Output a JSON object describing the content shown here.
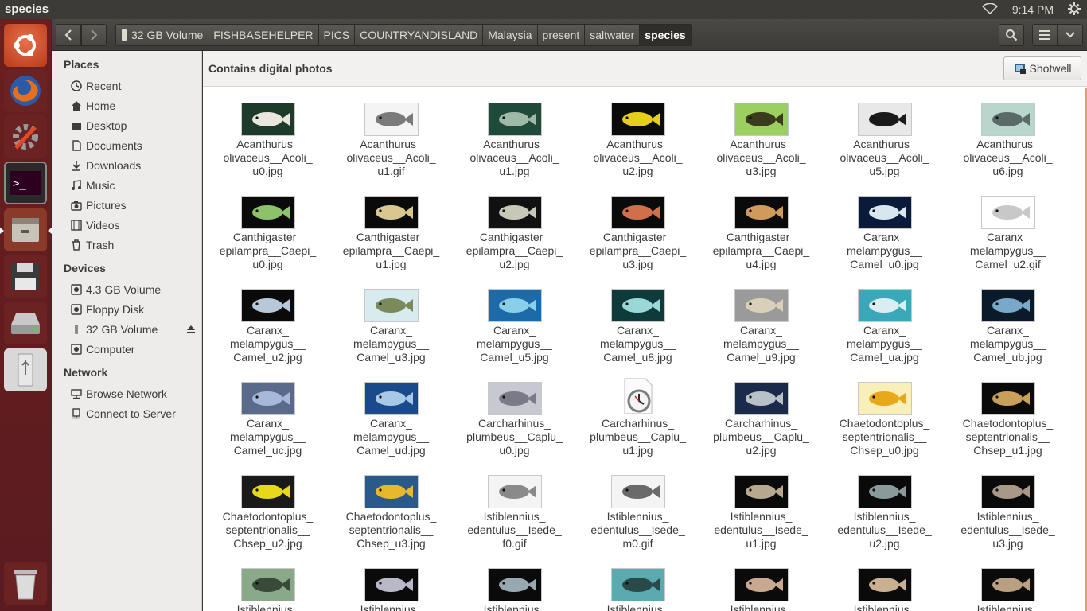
{
  "window": {
    "title": "species",
    "time": "9:14 PM"
  },
  "launcher": [
    {
      "name": "ubuntu-dash-icon"
    },
    {
      "name": "firefox-icon"
    },
    {
      "name": "system-settings-icon"
    },
    {
      "name": "terminal-icon"
    },
    {
      "name": "files-icon"
    },
    {
      "name": "floppy-disk-icon"
    },
    {
      "name": "hard-drive-icon"
    },
    {
      "name": "usb-drive-icon"
    },
    {
      "name": "trash-icon"
    }
  ],
  "breadcrumbs": [
    "32 GB Volume",
    "FISHBASEHELPER",
    "PICS",
    "COUNTRYANDISLAND",
    "Malaysia",
    "present",
    "saltwater",
    "species"
  ],
  "sidebar": {
    "places_heading": "Places",
    "places": [
      "Recent",
      "Home",
      "Desktop",
      "Documents",
      "Downloads",
      "Music",
      "Pictures",
      "Videos",
      "Trash"
    ],
    "devices_heading": "Devices",
    "devices": [
      "4.3 GB Volume",
      "Floppy Disk",
      "32 GB Volume",
      "Computer"
    ],
    "network_heading": "Network",
    "network": [
      "Browse Network",
      "Connect to Server"
    ]
  },
  "infobar": {
    "message": "Contains digital photos",
    "button": "Shotwell"
  },
  "files": [
    {
      "name": "Acanthurus_\nolivaceus__Acoli_\nu0.jpg",
      "bg": "#1d3a2a",
      "fish": "#e8e6dd"
    },
    {
      "name": "Acanthurus_\nolivaceus__Acoli_\nu1.gif",
      "bg": "#f4f4f4",
      "fish": "#7a7a7a"
    },
    {
      "name": "Acanthurus_\nolivaceus__Acoli_\nu1.jpg",
      "bg": "#1f4a3a",
      "fish": "#9fb9a8"
    },
    {
      "name": "Acanthurus_\nolivaceus__Acoli_\nu2.jpg",
      "bg": "#0a0a0a",
      "fish": "#e6cf1a"
    },
    {
      "name": "Acanthurus_\nolivaceus__Acoli_\nu3.jpg",
      "bg": "#9ccf61",
      "fish": "#3a3a1c"
    },
    {
      "name": "Acanthurus_\nolivaceus__Acoli_\nu5.jpg",
      "bg": "#e8e8e8",
      "fish": "#1a1a1a"
    },
    {
      "name": "Acanthurus_\nolivaceus__Acoli_\nu6.jpg",
      "bg": "#b8d6cc",
      "fish": "#5a6a66"
    },
    {
      "name": "Canthigaster_\nepilampra__Caepi_\nu0.jpg",
      "bg": "#0a0a0a",
      "fish": "#8ec26a"
    },
    {
      "name": "Canthigaster_\nepilampra__Caepi_\nu1.jpg",
      "bg": "#0a0a0a",
      "fish": "#d8c890"
    },
    {
      "name": "Canthigaster_\nepilampra__Caepi_\nu2.jpg",
      "bg": "#111111",
      "fish": "#c8c8b8"
    },
    {
      "name": "Canthigaster_\nepilampra__Caepi_\nu3.jpg",
      "bg": "#0a0a0a",
      "fish": "#d0704a"
    },
    {
      "name": "Canthigaster_\nepilampra__Caepi_\nu4.jpg",
      "bg": "#0a0a0a",
      "fish": "#d09a5a"
    },
    {
      "name": "Caranx_\nmelampygus__\nCamel_u0.jpg",
      "bg": "#0a1a3a",
      "fish": "#d8e6f0"
    },
    {
      "name": "Caranx_\nmelampygus__\nCamel_u2.gif",
      "bg": "#ffffff",
      "fish": "#c8c8c8"
    },
    {
      "name": "Caranx_\nmelampygus__\nCamel_u2.jpg",
      "bg": "#0a0a0a",
      "fish": "#b8c8d8"
    },
    {
      "name": "Caranx_\nmelampygus__\nCamel_u3.jpg",
      "bg": "#d8ecef",
      "fish": "#7a8a5a"
    },
    {
      "name": "Caranx_\nmelampygus__\nCamel_u5.jpg",
      "bg": "#1c6aa8",
      "fish": "#8acfe8"
    },
    {
      "name": "Caranx_\nmelampygus__\nCamel_u8.jpg",
      "bg": "#0e3a3a",
      "fish": "#9ad8d8"
    },
    {
      "name": "Caranx_\nmelampygus__\nCamel_u9.jpg",
      "bg": "#9a9a9a",
      "fish": "#d8d0b8"
    },
    {
      "name": "Caranx_\nmelampygus__\nCamel_ua.jpg",
      "bg": "#3aa8b8",
      "fish": "#d8eef0"
    },
    {
      "name": "Caranx_\nmelampygus__\nCamel_ub.jpg",
      "bg": "#0a1a2a",
      "fish": "#7aa8c8"
    },
    {
      "name": "Caranx_\nmelampygus__\nCamel_uc.jpg",
      "bg": "#5a6a8a",
      "fish": "#a8b8d8"
    },
    {
      "name": "Caranx_\nmelampygus__\nCamel_ud.jpg",
      "bg": "#1a4a8a",
      "fish": "#a8c8e8"
    },
    {
      "name": "Carcharhinus_\nplumbeus__Caplu_\nu0.jpg",
      "bg": "#c8c8d0",
      "fish": "#7a7a88"
    },
    {
      "name": "Carcharhinus_\nplumbeus__Caplu_\nu1.jpg",
      "bg": "#ffffff",
      "fish": "#888888",
      "clock": true
    },
    {
      "name": "Carcharhinus_\nplumbeus__Caplu_\nu2.jpg",
      "bg": "#1a2a4a",
      "fish": "#b8c0c8"
    },
    {
      "name": "Chaetodontoplus_\nseptentrionalis__\nChsep_u0.jpg",
      "bg": "#f8f0b8",
      "fish": "#e8a81a"
    },
    {
      "name": "Chaetodontoplus_\nseptentrionalis__\nChsep_u1.jpg",
      "bg": "#0a0a0a",
      "fish": "#c8a05a"
    },
    {
      "name": "Chaetodontoplus_\nseptentrionalis__\nChsep_u2.jpg",
      "bg": "#1a1a1a",
      "fish": "#e8d81a"
    },
    {
      "name": "Chaetodontoplus_\nseptentrionalis__\nChsep_u3.jpg",
      "bg": "#2a5a8a",
      "fish": "#e8b82a"
    },
    {
      "name": "Istiblennius_\nedentulus__Isede_\nf0.gif",
      "bg": "#f4f4f4",
      "fish": "#8a8a8a"
    },
    {
      "name": "Istiblennius_\nedentulus__Isede_\nm0.gif",
      "bg": "#f4f4f4",
      "fish": "#6a6a6a"
    },
    {
      "name": "Istiblennius_\nedentulus__Isede_\nu1.jpg",
      "bg": "#0a0a0a",
      "fish": "#b8a890"
    },
    {
      "name": "Istiblennius_\nedentulus__Isede_\nu2.jpg",
      "bg": "#0a0a0a",
      "fish": "#8a9a9a"
    },
    {
      "name": "Istiblennius_\nedentulus__Isede_\nu3.jpg",
      "bg": "#0a0a0a",
      "fish": "#a89888"
    },
    {
      "name": "Istiblennius_\nedentulus__Isede",
      "bg": "#8aa88a",
      "fish": "#3a4a3a"
    },
    {
      "name": "Istiblennius_\nedentulus__Isede",
      "bg": "#0a0a0a",
      "fish": "#b8b8c8"
    },
    {
      "name": "Istiblennius_\nedentulus__Isede",
      "bg": "#0a0a0a",
      "fish": "#98a8b0"
    },
    {
      "name": "Istiblennius_\nedentulus__Isede",
      "bg": "#5aaab0",
      "fish": "#2a4a4a"
    },
    {
      "name": "Istiblennius_\nedentulus__Isede",
      "bg": "#0a0a0a",
      "fish": "#c8a890"
    },
    {
      "name": "Istiblennius_\nedentulus__Isede",
      "bg": "#0a0a0a",
      "fish": "#c8b090"
    },
    {
      "name": "Istiblennius_\nedentulus__Isede",
      "bg": "#0a0a0a",
      "fish": "#b8a080"
    }
  ]
}
